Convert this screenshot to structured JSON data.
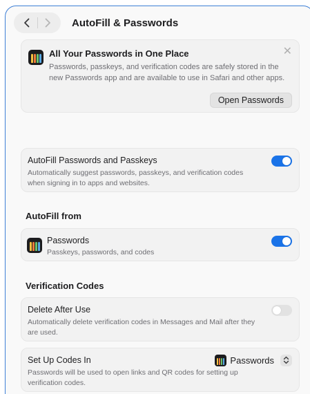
{
  "toolbar": {
    "title": "AutoFill & Passwords"
  },
  "promo": {
    "title": "All Your Passwords in One Place",
    "description": "Passwords, passkeys, and verification codes are safely stored in the new Passwords app and are available to use in Safari and other apps.",
    "open_button": "Open Passwords"
  },
  "autofill": {
    "title": "AutoFill Passwords and Passkeys",
    "description": "Automatically suggest passwords, passkeys, and verification codes when signing in to apps and websites.",
    "enabled": true
  },
  "autofill_from": {
    "section_title": "AutoFill from",
    "passwords_title": "Passwords",
    "passwords_desc": "Passkeys, passwords, and codes",
    "enabled": true
  },
  "verification": {
    "section_title": "Verification Codes",
    "delete_title": "Delete After Use",
    "delete_desc": "Automatically delete verification codes in Messages and Mail after they are used.",
    "delete_enabled": false,
    "setup_title": "Set Up Codes In",
    "setup_desc": "Passwords will be used to open links and QR codes for setting up verification codes.",
    "setup_value": "Passwords"
  },
  "icons": {
    "back": "chevron-left-icon",
    "forward": "chevron-right-icon",
    "close": "close-icon",
    "passwords_app": "passwords-app-icon",
    "stepper": "up-down-chevron-icon"
  },
  "colors": {
    "accent": "#1a73e8",
    "focus_border": "#3d7fd6"
  }
}
